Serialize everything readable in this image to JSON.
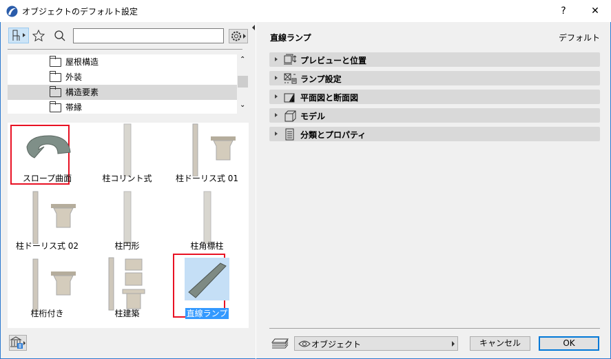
{
  "window": {
    "title": "オブジェクトのデフォルト設定",
    "help": "?",
    "close": "✕"
  },
  "left": {
    "search": {
      "value": "",
      "placeholder": ""
    },
    "tree": [
      {
        "label": "屋根構造",
        "selected": false
      },
      {
        "label": "外装",
        "selected": false
      },
      {
        "label": "構造要素",
        "selected": true
      },
      {
        "label": "帯縁",
        "selected": false
      }
    ],
    "thumbnails": [
      {
        "label": "スロープ曲面",
        "kind": "curved-slope",
        "marked": true,
        "selected": false
      },
      {
        "label": "柱コリント式",
        "kind": "column",
        "marked": false,
        "selected": false
      },
      {
        "label": "柱ドーリス式 01",
        "kind": "column-capital",
        "marked": false,
        "selected": false
      },
      {
        "label": "柱ドーリス式 02",
        "kind": "column-capital",
        "marked": false,
        "selected": false
      },
      {
        "label": "柱円形",
        "kind": "column",
        "marked": false,
        "selected": false
      },
      {
        "label": "柱角標柱",
        "kind": "column",
        "marked": false,
        "selected": false
      },
      {
        "label": "柱桁付き",
        "kind": "column-capital",
        "marked": false,
        "selected": false
      },
      {
        "label": "柱建築",
        "kind": "column-multi",
        "marked": false,
        "selected": false
      },
      {
        "label": "直線ランプ",
        "kind": "ramp",
        "marked": true,
        "selected": true
      }
    ]
  },
  "right": {
    "title": "直線ランプ",
    "default_label": "デフォルト",
    "sections": [
      {
        "label": "プレビューと位置",
        "icon": "preview-position-icon"
      },
      {
        "label": "ランプ設定",
        "icon": "ramp-settings-icon"
      },
      {
        "label": "平面図と断面図",
        "icon": "floorplan-section-icon"
      },
      {
        "label": "モデル",
        "icon": "model-icon"
      },
      {
        "label": "分類とプロパティ",
        "icon": "classification-icon"
      }
    ],
    "footer": {
      "view_label": "オブジェクト",
      "cancel": "キャンセル",
      "ok": "OK"
    }
  }
}
